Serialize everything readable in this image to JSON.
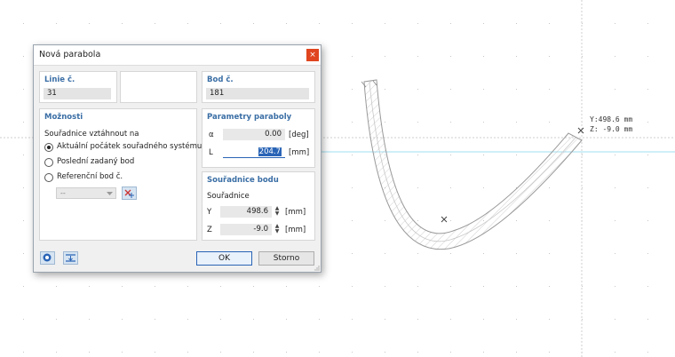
{
  "dialog": {
    "title": "Nová parabola",
    "close_glyph": "×",
    "line_section": {
      "title": "Linie č.",
      "value": "31"
    },
    "point_section": {
      "title": "Bod č.",
      "value": "181"
    },
    "options": {
      "title": "Možnosti",
      "relate_label": "Souřadnice vztáhnout na",
      "radio_options": [
        {
          "label": "Aktuální počátek souřadného systému",
          "selected": true
        },
        {
          "label": "Poslední zadaný bod",
          "selected": false
        },
        {
          "label": "Referenční bod č.",
          "selected": false
        }
      ],
      "ref_point_value": "--"
    },
    "parabola_params": {
      "title": "Parametry paraboly",
      "alpha": {
        "label": "α",
        "value": "0.00",
        "unit": "[deg]"
      },
      "length": {
        "label": "L",
        "value": "204.7",
        "unit": "[mm]"
      }
    },
    "point_coords": {
      "title": "Souřadnice bodu",
      "subtitle": "Souřadnice",
      "y": {
        "label": "Y",
        "value": "498.6",
        "unit": "[mm]"
      },
      "z": {
        "label": "Z",
        "value": "-9.0",
        "unit": "[mm]"
      }
    },
    "buttons": {
      "ok": "OK",
      "cancel": "Storno"
    }
  },
  "viewport": {
    "cursor_readout_y": "Y:498.6 mm",
    "cursor_readout_z": "Z: -9.0 mm"
  },
  "icons": [
    "close-icon",
    "pick-point-icon",
    "dropdown-arrow-icon",
    "info-icon",
    "snap-icon",
    "resize-grip-icon"
  ],
  "colors": {
    "accent": "#3a6ea5",
    "close": "#e0451f",
    "selection": "#2a64b6",
    "axis": "#9fdcf0"
  }
}
